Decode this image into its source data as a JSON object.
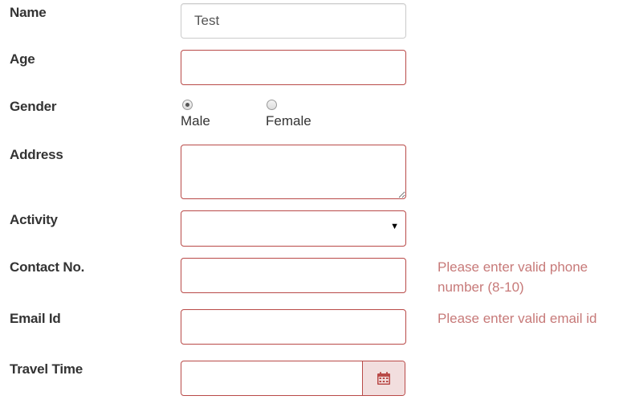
{
  "form": {
    "name": {
      "label": "Name",
      "value": "Test"
    },
    "age": {
      "label": "Age",
      "value": ""
    },
    "gender": {
      "label": "Gender",
      "options": [
        {
          "label": "Male",
          "checked": true
        },
        {
          "label": "Female",
          "checked": false
        }
      ]
    },
    "address": {
      "label": "Address",
      "value": ""
    },
    "activity": {
      "label": "Activity",
      "selected": ""
    },
    "contact": {
      "label": "Contact No.",
      "value": "",
      "error": "Please enter valid phone number (8-10)"
    },
    "email": {
      "label": "Email Id",
      "value": "",
      "error": "Please enter valid email id"
    },
    "travel_time": {
      "label": "Travel Time",
      "value": "",
      "icon": "calendar-icon"
    }
  },
  "colors": {
    "error_border": "#b94a48",
    "error_text": "#c77a79",
    "addon_bg": "#f2dede",
    "label_text": "#333333"
  }
}
